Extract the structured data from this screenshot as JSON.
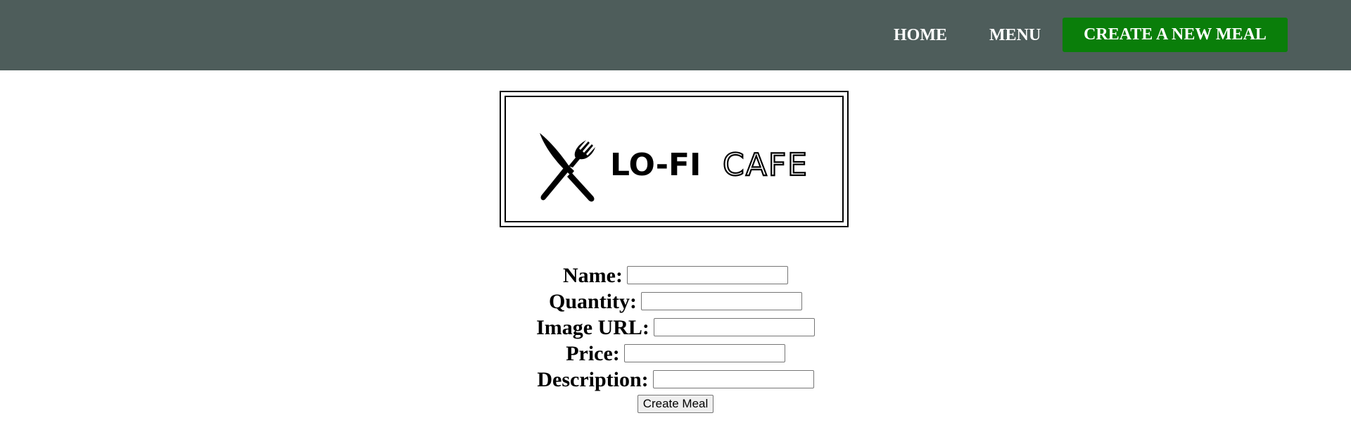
{
  "nav": {
    "home": "HOME",
    "menu": "MENU",
    "create": "CREATE A NEW MEAL"
  },
  "logo": {
    "text_bold": "LO-FI",
    "text_light": "CAFE",
    "icon": "crossed-knife-fork-icon"
  },
  "form": {
    "fields": [
      {
        "label": "Name:",
        "value": ""
      },
      {
        "label": "Quantity:",
        "value": ""
      },
      {
        "label": "Image URL:",
        "value": ""
      },
      {
        "label": "Price:",
        "value": ""
      },
      {
        "label": "Description:",
        "value": ""
      }
    ],
    "submit": "Create Meal"
  },
  "colors": {
    "navbar": "#4e5d5b",
    "create_button": "#0a7e0a"
  }
}
